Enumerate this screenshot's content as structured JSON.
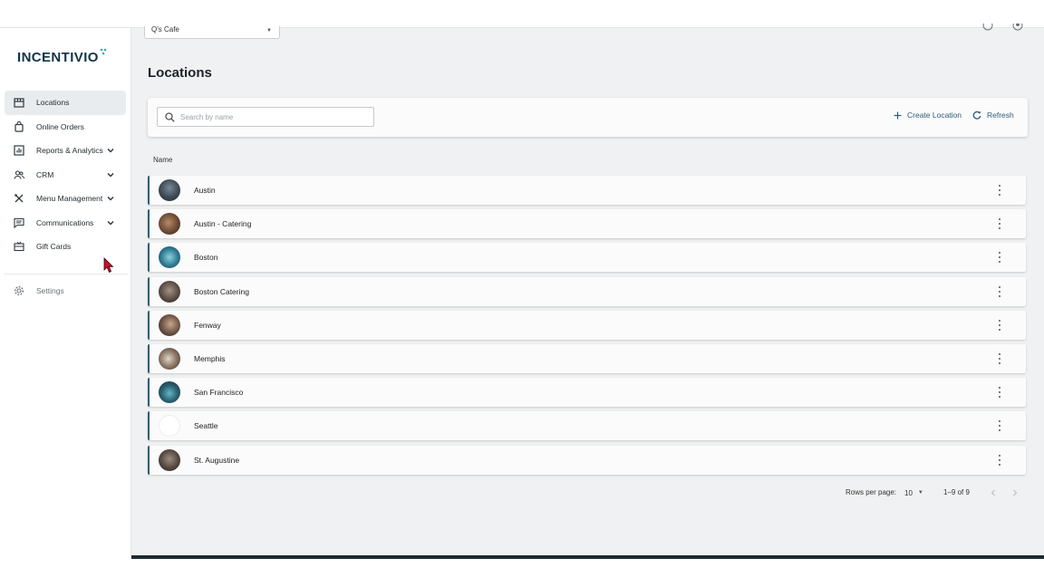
{
  "brand": {
    "logo_text": "INCENTIVIO",
    "selected_brand": "Q's Cafe"
  },
  "sidebar": {
    "items": [
      {
        "label": "Locations",
        "icon": "store-icon",
        "active": true,
        "expandable": false
      },
      {
        "label": "Online Orders",
        "icon": "shopping-bag-icon",
        "active": false,
        "expandable": false
      },
      {
        "label": "Reports & Analytics",
        "icon": "analytics-icon",
        "active": false,
        "expandable": true
      },
      {
        "label": "CRM",
        "icon": "people-icon",
        "active": false,
        "expandable": true
      },
      {
        "label": "Menu Management",
        "icon": "utensils-icon",
        "active": false,
        "expandable": true
      },
      {
        "label": "Communications",
        "icon": "message-icon",
        "active": false,
        "expandable": true
      },
      {
        "label": "Gift Cards",
        "icon": "gift-card-icon",
        "active": false,
        "expandable": false
      }
    ],
    "settings_label": "Settings"
  },
  "page": {
    "title": "Locations"
  },
  "toolbar": {
    "search_placeholder": "Search by name",
    "create_label": "Create Location",
    "refresh_label": "Refresh"
  },
  "table": {
    "column_name": "Name",
    "rows": [
      {
        "name": "Austin"
      },
      {
        "name": "Austin - Catering"
      },
      {
        "name": "Boston"
      },
      {
        "name": "Boston Catering"
      },
      {
        "name": "Fenway"
      },
      {
        "name": "Memphis"
      },
      {
        "name": "San Francisco"
      },
      {
        "name": "Seattle"
      },
      {
        "name": "St. Augustine"
      }
    ]
  },
  "pagination": {
    "rows_per_page_label": "Rows per page:",
    "rows_per_page_value": "10",
    "range_text": "1–9 of 9"
  },
  "colors": {
    "accent": "#2d5e79",
    "logo_mark": "#3aa9b8",
    "background": "#f0f1f2"
  }
}
